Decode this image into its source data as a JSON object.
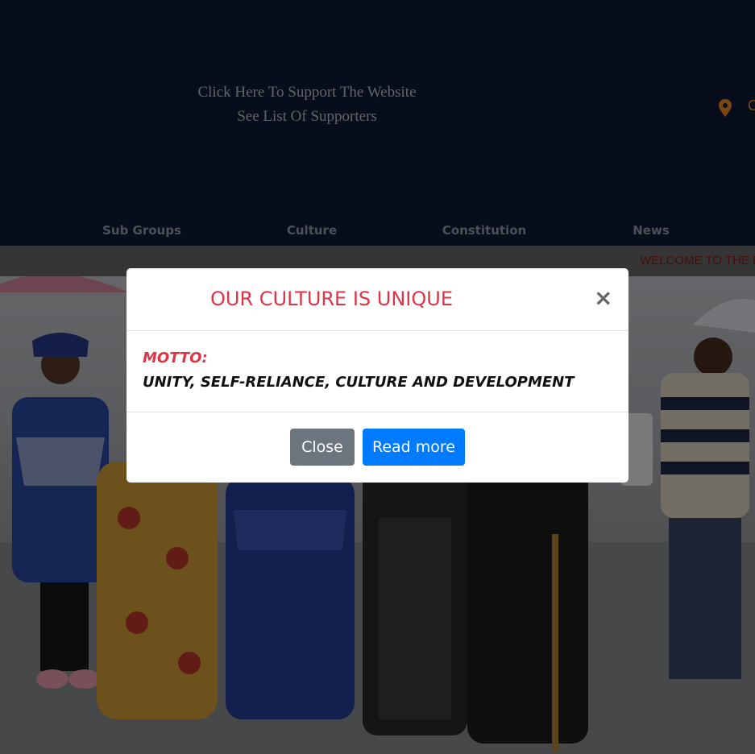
{
  "header": {
    "support_line": "Click Here To Support The Website",
    "supporters_line": "See List Of Supporters",
    "location_icon": "map-marker-icon",
    "location_text_fragment": "C",
    "accent_color": "#f28c28"
  },
  "nav": {
    "items": [
      {
        "label": "Sub Groups"
      },
      {
        "label": "Culture"
      },
      {
        "label": "Constitution"
      },
      {
        "label": "News"
      }
    ]
  },
  "ticker": {
    "text": "WELCOME TO THE B"
  },
  "modal": {
    "title": "OUR CULTURE IS UNIQUE",
    "close_icon": "close-icon",
    "motto_label": "MOTTO:",
    "motto_text": "UNITY, SELF-RELIANCE, CULTURE AND DEVELOPMENT",
    "close_button": "Close",
    "read_more_button": "Read more",
    "title_color": "#dc3545",
    "primary_color": "#007bff",
    "secondary_color": "#6c757d"
  }
}
